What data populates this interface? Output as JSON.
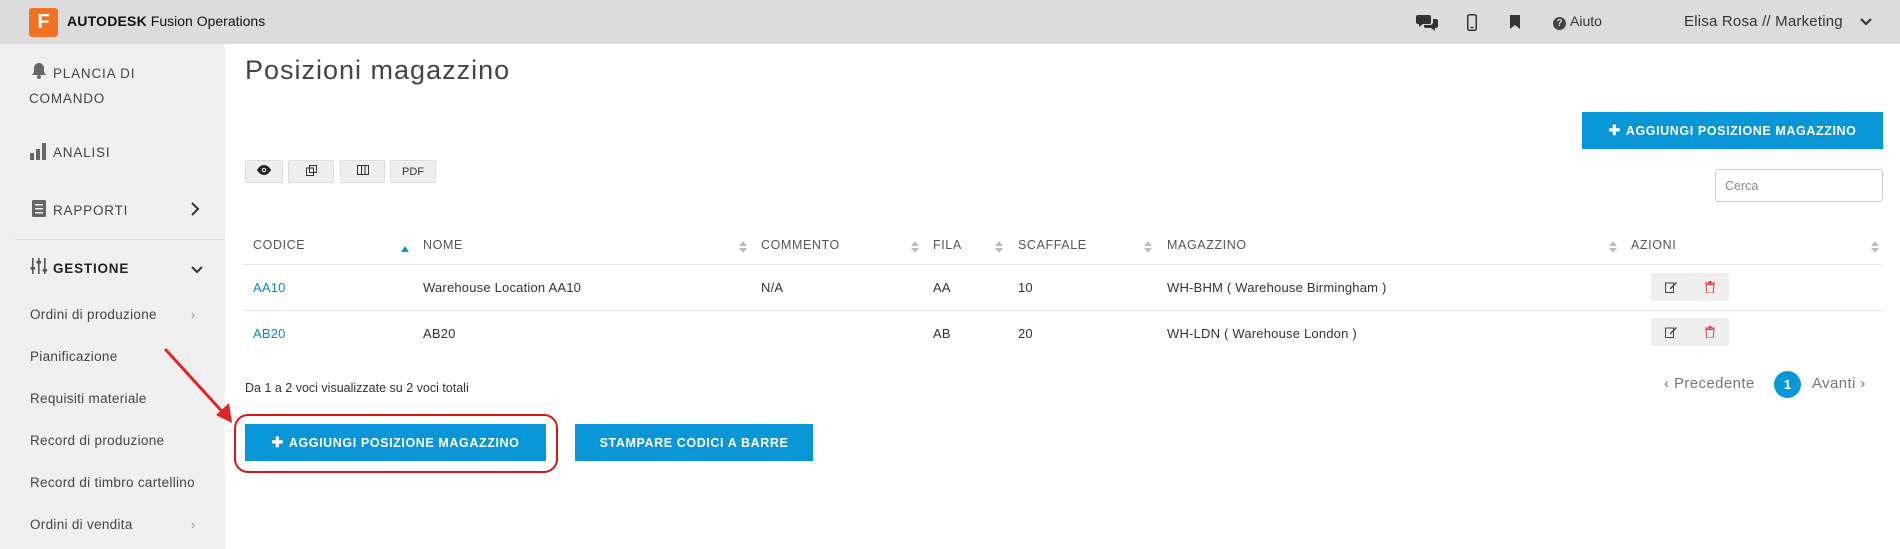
{
  "header": {
    "logo_letter": "F",
    "brand_bold": "AUTODESK",
    "brand_rest": "Fusion Operations",
    "help_label": "Aiuto",
    "user_label": "Elisa Rosa // Marketing",
    "icons": [
      "chat-icon",
      "mobile-icon",
      "bookmark-icon",
      "help-icon",
      "chevron-down-icon"
    ]
  },
  "sidebar": {
    "items": [
      {
        "label_line1": "PLANCIA DI",
        "label_line2": "COMANDO",
        "icon": "bell-icon"
      },
      {
        "label": "ANALISI",
        "icon": "bar-chart-icon"
      },
      {
        "label": "RAPPORTI",
        "icon": "report-icon"
      },
      {
        "label": "GESTIONE",
        "icon": "sliders-icon",
        "active": true
      }
    ],
    "sub_items": [
      {
        "label": "Ordini di produzione",
        "has_arrow": true
      },
      {
        "label": "Pianificazione"
      },
      {
        "label": "Requisiti materiale"
      },
      {
        "label": "Record di produzione"
      },
      {
        "label": "Record di timbro cartellino"
      },
      {
        "label": "Ordini di vendita",
        "has_arrow": true
      }
    ]
  },
  "main": {
    "title": "Posizioni magazzino",
    "add_button_top": "AGGIUNGI POSIZIONE MAGAZZINO",
    "toolbar": {
      "pdf_label": "PDF",
      "icons": [
        "eye-icon",
        "copy-icon",
        "columns-icon"
      ]
    },
    "search_placeholder": "Cerca",
    "table": {
      "columns": [
        "CODICE",
        "NOME",
        "COMMENTO",
        "FILA",
        "SCAFFALE",
        "MAGAZZINO",
        "AZIONI"
      ],
      "rows": [
        {
          "codice": "AA10",
          "nome": "Warehouse Location AA10",
          "commento": "N/A",
          "fila": "AA",
          "scaffale": "10",
          "magazzino": "WH-BHM ( Warehouse Birmingham )"
        },
        {
          "codice": "AB20",
          "nome": "AB20",
          "commento": "",
          "fila": "AB",
          "scaffale": "20",
          "magazzino": "WH-LDN ( Warehouse London )"
        }
      ]
    },
    "info_text": "Da 1 a 2 voci visualizzate su 2 voci totali",
    "pager": {
      "prev": "Precedente",
      "page": "1",
      "next": "Avanti"
    },
    "add_button_bottom": "AGGIUNGI POSIZIONE MAGAZZINO",
    "print_button": "STAMPARE CODICI A BARRE"
  },
  "colors": {
    "accent": "#0996d6",
    "brand": "#f27022",
    "highlight": "#d9151b",
    "link": "#0a88c9"
  }
}
